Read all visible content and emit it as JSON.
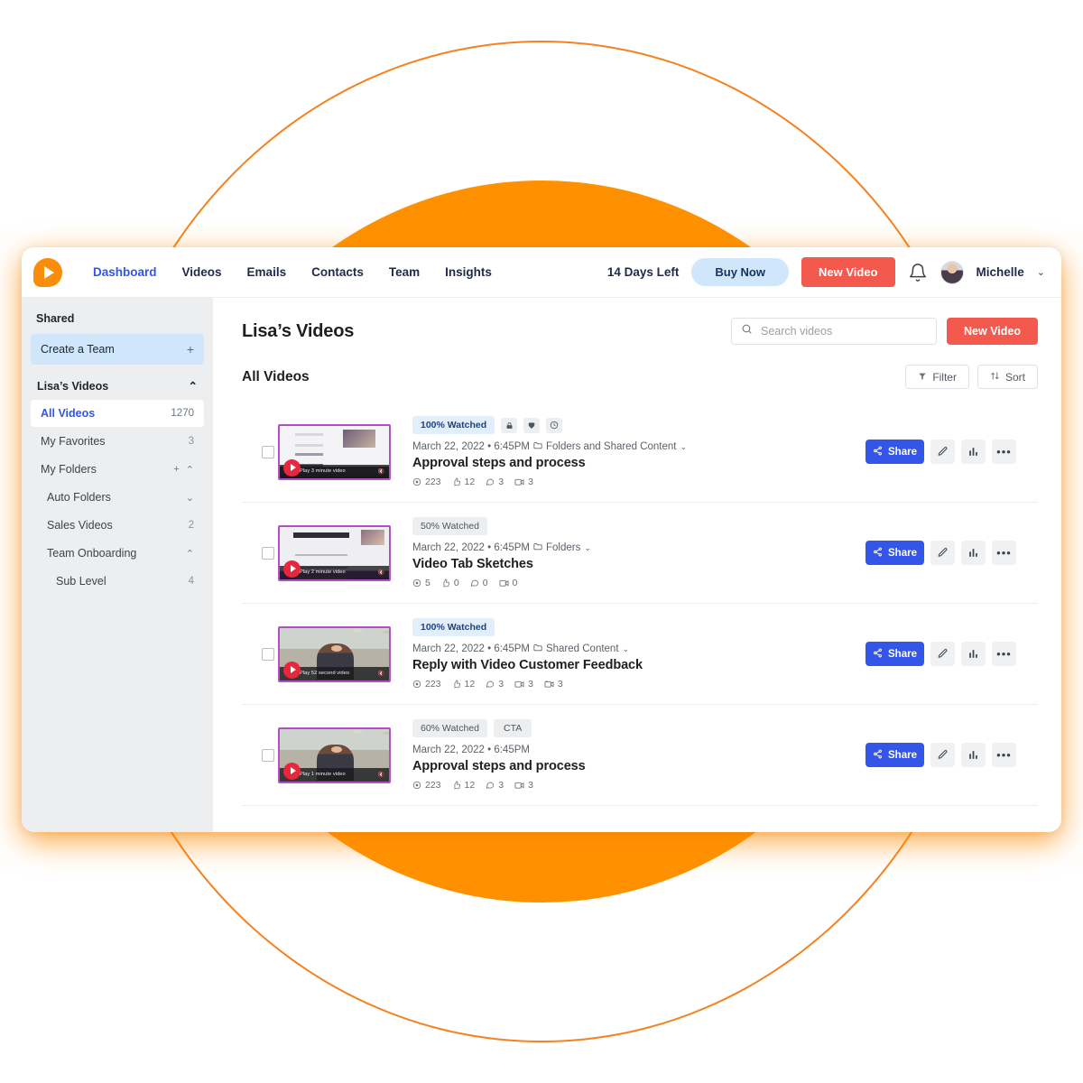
{
  "decor": {
    "fill_color": "#FF9100",
    "outline_color": "#F58220"
  },
  "topnav": {
    "logo_name": "vidyard-logo",
    "links": [
      {
        "label": "Dashboard",
        "active": true
      },
      {
        "label": "Videos",
        "active": false
      },
      {
        "label": "Emails",
        "active": false
      },
      {
        "label": "Contacts",
        "active": false
      },
      {
        "label": "Team",
        "active": false
      },
      {
        "label": "Insights",
        "active": false
      }
    ],
    "days_left": "14 Days Left",
    "buy_now": "Buy Now",
    "new_video": "New Video",
    "user_name": "Michelle",
    "chevron": "⌄"
  },
  "sidebar": {
    "shared_label": "Shared",
    "create_team": {
      "label": "Create a Team",
      "plus": "+"
    },
    "section": {
      "label": "Lisa’s Videos",
      "caret": "⌃"
    },
    "items": [
      {
        "label": "All Videos",
        "count": "1270",
        "active": true,
        "indent": 0
      },
      {
        "label": "My Favorites",
        "count": "3",
        "active": false,
        "indent": 0
      },
      {
        "label": "My Folders",
        "count": "",
        "active": false,
        "indent": 0,
        "plus": "+",
        "caret": "⌃"
      },
      {
        "label": "Auto Folders",
        "count": "",
        "active": false,
        "indent": 1,
        "caret": "⌄"
      },
      {
        "label": "Sales Videos",
        "count": "2",
        "active": false,
        "indent": 1
      },
      {
        "label": "Team Onboarding",
        "count": "",
        "active": false,
        "indent": 1,
        "caret": "⌃"
      },
      {
        "label": "Sub Level",
        "count": "4",
        "active": false,
        "indent": 2
      }
    ]
  },
  "main": {
    "page_title": "Lisa’s Videos",
    "search": {
      "placeholder": "Search videos",
      "value": ""
    },
    "new_video": "New Video",
    "subhead": "All Videos",
    "filter": "Filter",
    "sort": "Sort",
    "share_label": "Share"
  },
  "videos": [
    {
      "watched": "100% Watched",
      "watched_style": "blue",
      "badge_icons": [
        "lock-icon",
        "heart-icon",
        "clock-icon"
      ],
      "cta": "",
      "date": "March 22, 2022 • 6:45PM",
      "folder": "Folders and Shared Content",
      "has_folder": true,
      "title": "Approval steps and process",
      "play_label": "Play 3 minute video",
      "thumb_class": "t1",
      "stats": {
        "views": "223",
        "likes": "12",
        "comments": "3",
        "videos": "3",
        "replies": ""
      }
    },
    {
      "watched": "50% Watched",
      "watched_style": "gray",
      "badge_icons": [],
      "cta": "",
      "date": "March 22, 2022 • 6:45PM",
      "folder": "Folders",
      "has_folder": true,
      "title": "Video Tab Sketches",
      "play_label": "Play 2 minute video",
      "thumb_class": "t2",
      "stats": {
        "views": "5",
        "likes": "0",
        "comments": "0",
        "videos": "0",
        "replies": ""
      }
    },
    {
      "watched": "100% Watched",
      "watched_style": "blue",
      "badge_icons": [],
      "cta": "",
      "date": "March 22, 2022 • 6:45PM",
      "folder": "Shared Content",
      "has_folder": true,
      "title": "Reply with Video Customer Feedback",
      "play_label": "Play 52 second video",
      "thumb_class": "t3",
      "stats": {
        "views": "223",
        "likes": "12",
        "comments": "3",
        "videos": "3",
        "replies": "3"
      }
    },
    {
      "watched": "60% Watched",
      "watched_style": "gray",
      "badge_icons": [],
      "cta": "CTA",
      "date": "March 22, 2022 • 6:45PM",
      "folder": "",
      "has_folder": false,
      "title": "Approval steps and process",
      "play_label": "Play 1 minute video",
      "thumb_class": "t4",
      "stats": {
        "views": "223",
        "likes": "12",
        "comments": "3",
        "videos": "3",
        "replies": ""
      }
    }
  ]
}
